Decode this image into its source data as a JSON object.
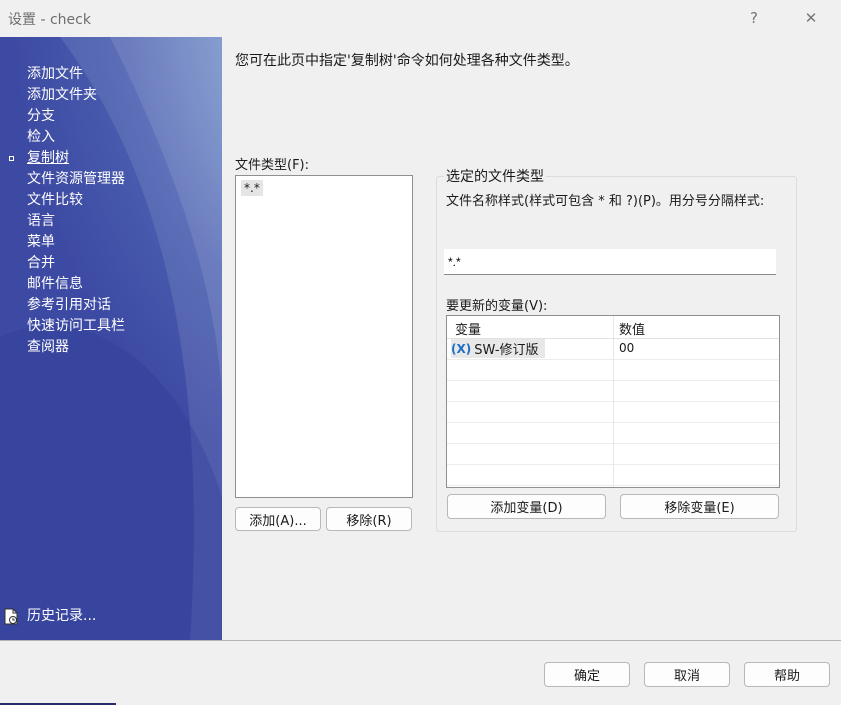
{
  "window": {
    "title": "设置 - check",
    "help": "?",
    "close": "✕"
  },
  "sidebar": {
    "items": [
      {
        "label": "添加文件",
        "active": false
      },
      {
        "label": "添加文件夹",
        "active": false
      },
      {
        "label": "分支",
        "active": false
      },
      {
        "label": "检入",
        "active": false
      },
      {
        "label": "复制树",
        "active": true
      },
      {
        "label": "文件资源管理器",
        "active": false
      },
      {
        "label": "文件比较",
        "active": false
      },
      {
        "label": "语言",
        "active": false
      },
      {
        "label": "菜单",
        "active": false
      },
      {
        "label": "合并",
        "active": false
      },
      {
        "label": "邮件信息",
        "active": false
      },
      {
        "label": "参考引用对话",
        "active": false
      },
      {
        "label": "快速访问工具栏",
        "active": false
      },
      {
        "label": "查阅器",
        "active": false
      }
    ],
    "history": "历史记录..."
  },
  "main": {
    "description": "您可在此页中指定'复制树'命令如何处理各种文件类型。",
    "file_types_label": "文件类型(F):",
    "file_types": [
      "*.*"
    ],
    "add_button": "添加(A)...",
    "remove_button": "移除(R)",
    "selected_group_title": "选定的文件类型",
    "pattern_label": "文件名称样式(样式可包含 * 和 ?)(P)。用分号分隔样式:",
    "pattern_value": "*.*",
    "variables_label": "要更新的变量(V):",
    "variables_headers": {
      "variable": "变量",
      "value": "数值"
    },
    "variables": [
      {
        "icon": "(X)",
        "name": "SW-修订版",
        "value": "00"
      }
    ],
    "add_variable_button": "添加变量(D)",
    "remove_variable_button": "移除变量(E)"
  },
  "footer": {
    "ok": "确定",
    "cancel": "取消",
    "help": "帮助"
  }
}
